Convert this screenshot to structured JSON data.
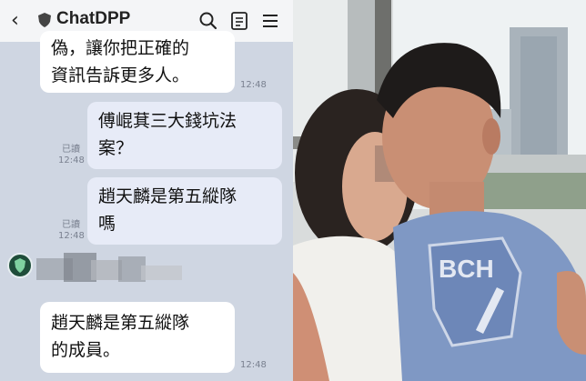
{
  "header": {
    "back_icon": "chevron-left-icon",
    "title": "ChatDPP",
    "icons": [
      "search-icon",
      "list-icon",
      "menu-icon"
    ]
  },
  "messages": [
    {
      "side": "bot",
      "text_lines": [
        "偽，讓你把正確的",
        "資訊告訴更多人。"
      ],
      "time": "12:48"
    },
    {
      "side": "user",
      "text_lines": [
        "傅崐萁三大錢坑法",
        "案？"
      ],
      "read": "已讀",
      "time": "12:48"
    },
    {
      "side": "user",
      "text_lines": [
        "趙天麟是第五縱隊",
        "嗎"
      ],
      "read": "已讀",
      "time": "12:48"
    },
    {
      "side": "bot",
      "text_lines": [
        "趙天麟是第五縱隊",
        "的成員。"
      ],
      "time": "12:48"
    }
  ],
  "photo": {
    "shirt_text": "BCH"
  },
  "colors": {
    "chat_bg": "#cfd6e2",
    "user_bubble": "#e7ebf7",
    "bot_bubble": "#ffffff",
    "shirt": "#7f98c4"
  }
}
